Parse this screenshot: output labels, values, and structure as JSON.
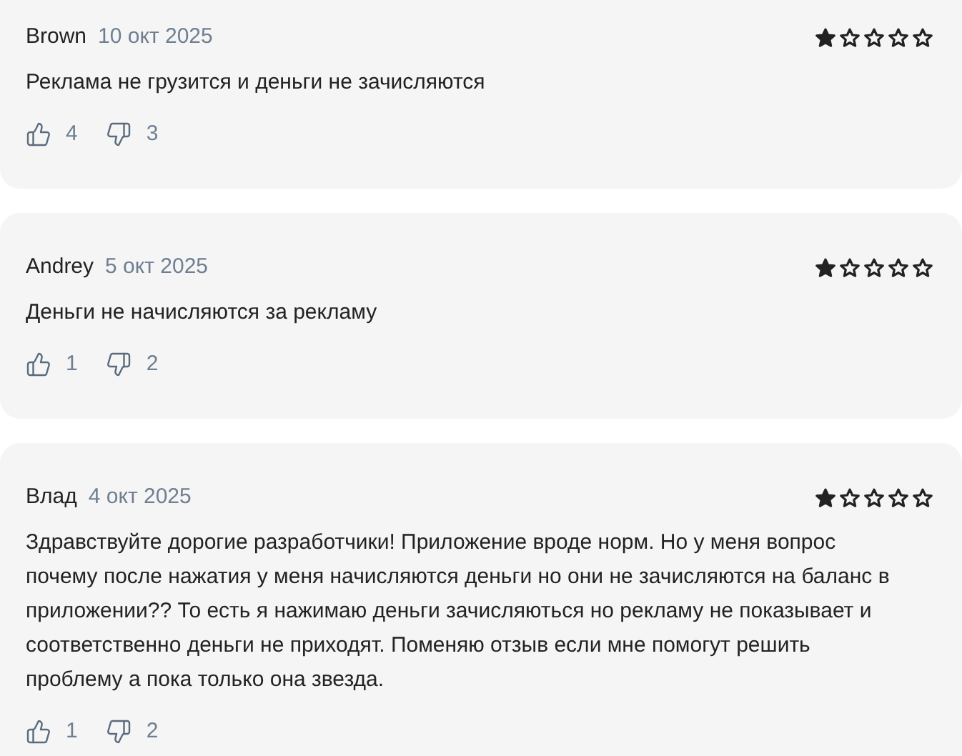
{
  "reviews": [
    {
      "author": "Brown",
      "date": "10 окт 2025",
      "stars": 1,
      "text": "Реклама не грузится и деньги не зачисляются",
      "likes": "4",
      "dislikes": "3"
    },
    {
      "author": "Andrey",
      "date": "5 окт 2025",
      "stars": 1,
      "text": "Деньги не начисляются за рекламу",
      "likes": "1",
      "dislikes": "2"
    },
    {
      "author": "Влад",
      "date": "4 окт 2025",
      "stars": 1,
      "text": "Здравствуйте дорогие разработчики! Приложение вроде норм. Но у меня вопрос почему после нажатия у меня начисляются деньги но они не зачисляются на баланс в приложении?? То есть я нажимаю деньги зачисляються но рекламу не показывает и соответственно деньги не приходят. Поменяю отзыв если мне помогут решить проблему а пока только она звезда.",
      "likes": "1",
      "dislikes": "2"
    }
  ]
}
